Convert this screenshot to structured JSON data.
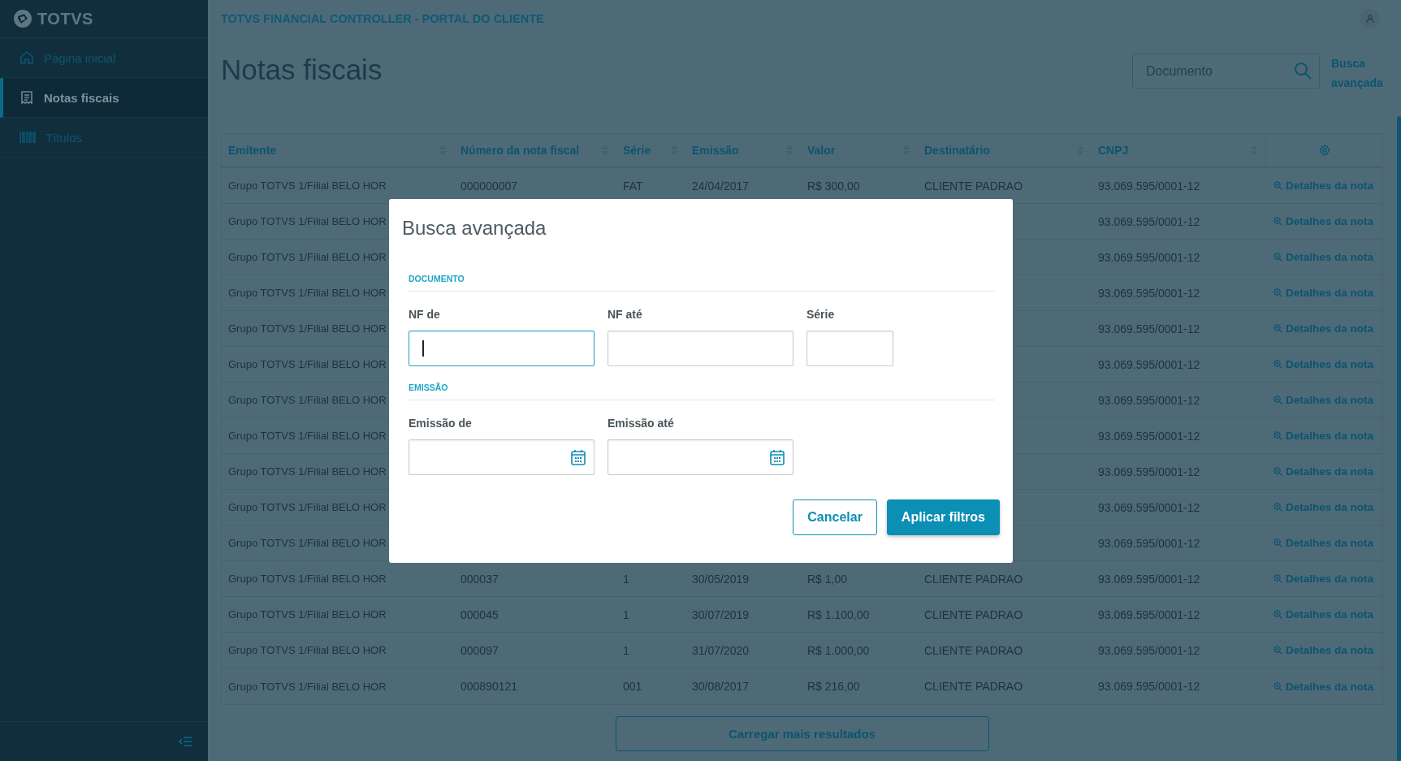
{
  "sidebar": {
    "logo": "TOTVS",
    "items": [
      {
        "label": "Página inicial",
        "selected": false
      },
      {
        "label": "Notas fiscais",
        "selected": true
      },
      {
        "label": "Títulos",
        "selected": false
      }
    ]
  },
  "topbar": {
    "title": "TOTVS FINANCIAL CONTROLLER - PORTAL DO CLIENTE"
  },
  "page": {
    "title": "Notas fiscais",
    "search": {
      "placeholder": "Documento"
    },
    "advanced_search_link": "Busca avançada"
  },
  "table": {
    "columns": [
      "Emitente",
      "Número da nota fiscal",
      "Série",
      "Emissão",
      "Valor",
      "Destinatário",
      "CNPJ"
    ],
    "rows": [
      {
        "emitente": "Grupo TOTVS 1/Filial BELO HOR",
        "numero": "000000007",
        "serie": "FAT",
        "emissao": "24/04/2017",
        "valor": "R$ 300,00",
        "destinatario": "CLIENTE PADRAO",
        "cnpj": "93.069.595/0001-12",
        "action": "Detalhes da nota"
      },
      {
        "emitente": "Grupo TOTVS 1/Filial BELO HOR",
        "cnpj": "93.069.595/0001-12",
        "action": "Detalhes da nota"
      },
      {
        "emitente": "Grupo TOTVS 1/Filial BELO HOR",
        "cnpj": "93.069.595/0001-12",
        "action": "Detalhes da nota"
      },
      {
        "emitente": "Grupo TOTVS 1/Filial BELO HOR",
        "cnpj": "93.069.595/0001-12",
        "action": "Detalhes da nota"
      },
      {
        "emitente": "Grupo TOTVS 1/Filial BELO HOR",
        "cnpj": "93.069.595/0001-12",
        "action": "Detalhes da nota"
      },
      {
        "emitente": "Grupo TOTVS 1/Filial BELO HOR",
        "cnpj": "93.069.595/0001-12",
        "action": "Detalhes da nota"
      },
      {
        "emitente": "Grupo TOTVS 1/Filial BELO HOR",
        "cnpj": "93.069.595/0001-12",
        "action": "Detalhes da nota"
      },
      {
        "emitente": "Grupo TOTVS 1/Filial BELO HOR",
        "cnpj": "93.069.595/0001-12",
        "action": "Detalhes da nota"
      },
      {
        "emitente": "Grupo TOTVS 1/Filial BELO HOR",
        "cnpj": "93.069.595/0001-12",
        "action": "Detalhes da nota"
      },
      {
        "emitente": "Grupo TOTVS 1/Filial BELO HOR",
        "cnpj": "93.069.595/0001-12",
        "action": "Detalhes da nota"
      },
      {
        "emitente": "Grupo TOTVS 1/Filial BELO HOR",
        "cnpj": "93.069.595/0001-12",
        "action": "Detalhes da nota"
      },
      {
        "emitente": "Grupo TOTVS 1/Filial BELO HOR",
        "numero": "000037",
        "serie": "1",
        "emissao": "30/05/2019",
        "valor": "R$ 1,00",
        "destinatario": "CLIENTE PADRAO",
        "cnpj": "93.069.595/0001-12",
        "action": "Detalhes da nota"
      },
      {
        "emitente": "Grupo TOTVS 1/Filial BELO HOR",
        "numero": "000045",
        "serie": "1",
        "emissao": "30/07/2019",
        "valor": "R$ 1.100,00",
        "destinatario": "CLIENTE PADRAO",
        "cnpj": "93.069.595/0001-12",
        "action": "Detalhes da nota"
      },
      {
        "emitente": "Grupo TOTVS 1/Filial BELO HOR",
        "numero": "000097",
        "serie": "1",
        "emissao": "31/07/2020",
        "valor": "R$ 1.000,00",
        "destinatario": "CLIENTE PADRAO",
        "cnpj": "93.069.595/0001-12",
        "action": "Detalhes da nota"
      },
      {
        "emitente": "Grupo TOTVS 1/Filial BELO HOR",
        "numero": "000890121",
        "serie": "001",
        "emissao": "30/08/2017",
        "valor": "R$ 216,00",
        "destinatario": "CLIENTE PADRAO",
        "cnpj": "93.069.595/0001-12",
        "action": "Detalhes da nota"
      }
    ]
  },
  "load_more": "Carregar mais resultados",
  "dialog": {
    "title": "Busca avançada",
    "sections": [
      {
        "label": "DOCUMENTO",
        "fields": [
          {
            "label": "NF de",
            "kind": "text",
            "focused": true
          },
          {
            "label": "NF até",
            "kind": "text",
            "focused": false
          },
          {
            "label": "Série",
            "kind": "text",
            "focused": false
          }
        ]
      },
      {
        "label": "EMISSÃO",
        "fields": [
          {
            "label": "Emissão de",
            "kind": "date",
            "focused": false
          },
          {
            "label": "Emissão até",
            "kind": "date",
            "focused": false
          }
        ]
      }
    ],
    "buttons": [
      {
        "label": "Cancelar",
        "kind": "secondary"
      },
      {
        "label": "Aplicar filtros",
        "kind": "primary"
      }
    ]
  }
}
